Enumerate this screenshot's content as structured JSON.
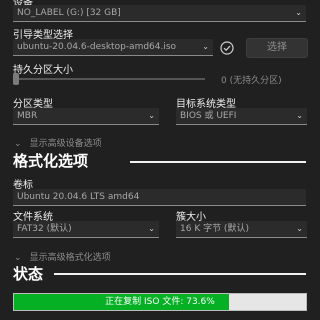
{
  "device": {
    "label": "设备",
    "value": "NO_LABEL (G:) [32 GB]"
  },
  "boot": {
    "label": "引导类型选择",
    "value": "ubuntu-20.04.6-desktop-amd64.iso",
    "select_button": "选择"
  },
  "persistent": {
    "label": "持久分区大小",
    "value_text": "0 (无持久分区)",
    "value": 0
  },
  "partition": {
    "label": "分区类型",
    "value": "MBR"
  },
  "target": {
    "label": "目标系统类型",
    "value": "BIOS 或 UEFI"
  },
  "show_advanced_device": "显示高级设备选项",
  "format_section": {
    "title": "格式化选项",
    "volume_label": "卷标",
    "volume_value": "Ubuntu 20.04.6 LTS amd64",
    "fs_label": "文件系统",
    "fs_value": "FAT32 (默认)",
    "cluster_label": "簇大小",
    "cluster_value": "16 K 字节 (默认)",
    "show_advanced_format": "显示高级格式化选项"
  },
  "status_section": {
    "title": "状态",
    "progress_text": "正在复制 ISO 文件: 73.6%",
    "progress_percent": 73.6
  },
  "colors": {
    "background": "#202020",
    "progress_fill": "#06b025",
    "field_background": "#2b2b2b"
  }
}
